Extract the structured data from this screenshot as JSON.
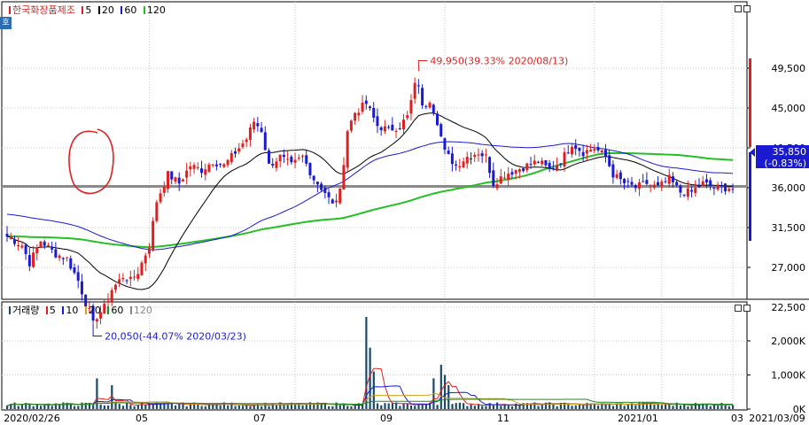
{
  "qmark": "호",
  "price_legend": {
    "title": "한국화장품제조",
    "ma": [
      {
        "label": "5",
        "color": "#e02020"
      },
      {
        "label": "20",
        "color": "#000000"
      },
      {
        "label": "60",
        "color": "#1a1ad0"
      },
      {
        "label": "120",
        "color": "#22c022"
      }
    ]
  },
  "volume_legend": {
    "title": "거래량",
    "ma": [
      {
        "label": "5",
        "color": "#e02020"
      },
      {
        "label": "10",
        "color": "#1a1ad0"
      },
      {
        "label": "20",
        "color": "#d4a020"
      },
      {
        "label": "60",
        "color": "#228822"
      },
      {
        "label": "120",
        "color": "#888888"
      }
    ]
  },
  "colors": {
    "up": "#e02020",
    "down": "#1a1ad0",
    "ma120": "#22c022",
    "volume": "#1a4a6a",
    "refline": "#8a8a8a"
  },
  "annotations": {
    "high": "49,950(39.33% 2020/08/13)",
    "low": "20,050(-44.07% 2020/03/23)"
  },
  "current": {
    "price": "35,850",
    "change": "(-0.83%)"
  },
  "chart_data": {
    "type": "candlestick",
    "title": "한국화장품제조",
    "price_axis": {
      "ticks": [
        "49,500",
        "45,000",
        "40,500",
        "36,000",
        "31,500",
        "27,000",
        "22,500"
      ],
      "range": [
        18000,
        52000
      ]
    },
    "volume_axis": {
      "ticks": [
        "2,000K",
        "1,000K",
        "0K"
      ],
      "range": [
        0,
        2900000
      ]
    },
    "x_ticks": [
      "2020/02/26",
      "05",
      "07",
      "09",
      "11",
      "2021/01",
      "03",
      "2021/03/09"
    ],
    "reference_price": 36150,
    "high": {
      "value": 49950,
      "change_pct": 39.33,
      "date": "2020/08/13"
    },
    "low": {
      "value": 20050,
      "change_pct": -44.07,
      "date": "2020/03/23"
    },
    "last": {
      "value": 35850,
      "change_pct": -0.83
    },
    "close_path": [
      [
        0,
        30500
      ],
      [
        4,
        29500
      ],
      [
        6,
        27500
      ],
      [
        9,
        30000
      ],
      [
        13,
        28500
      ],
      [
        16,
        28000
      ],
      [
        19,
        25500
      ],
      [
        21,
        23000
      ],
      [
        23,
        21000
      ],
      [
        26,
        22500
      ],
      [
        28,
        24500
      ],
      [
        31,
        26000
      ],
      [
        33,
        25500
      ],
      [
        35,
        26500
      ],
      [
        38,
        29500
      ],
      [
        40,
        34500
      ],
      [
        43,
        37500
      ],
      [
        46,
        36500
      ],
      [
        49,
        38500
      ],
      [
        52,
        38000
      ],
      [
        55,
        39000
      ],
      [
        58,
        38500
      ],
      [
        61,
        40000
      ],
      [
        64,
        41500
      ],
      [
        66,
        43500
      ],
      [
        68,
        42500
      ],
      [
        70,
        38500
      ],
      [
        73,
        39500
      ],
      [
        76,
        38500
      ],
      [
        79,
        39500
      ],
      [
        82,
        37000
      ],
      [
        85,
        35500
      ],
      [
        87,
        34000
      ],
      [
        89,
        35500
      ],
      [
        91,
        42500
      ],
      [
        93,
        44500
      ],
      [
        96,
        45500
      ],
      [
        99,
        43000
      ],
      [
        102,
        42500
      ],
      [
        105,
        43000
      ],
      [
        107,
        44000
      ],
      [
        109,
        47500
      ],
      [
        111,
        45000
      ],
      [
        113,
        46000
      ],
      [
        115,
        43500
      ],
      [
        117,
        40000
      ],
      [
        120,
        38500
      ],
      [
        123,
        39500
      ],
      [
        126,
        40000
      ],
      [
        128,
        39500
      ],
      [
        130,
        36500
      ],
      [
        133,
        37500
      ],
      [
        136,
        38000
      ],
      [
        139,
        38500
      ],
      [
        142,
        39000
      ],
      [
        145,
        38000
      ],
      [
        148,
        39000
      ],
      [
        151,
        41000
      ],
      [
        154,
        40000
      ],
      [
        157,
        40500
      ],
      [
        160,
        39500
      ],
      [
        162,
        37500
      ],
      [
        165,
        36500
      ],
      [
        168,
        36000
      ],
      [
        171,
        36500
      ],
      [
        174,
        36000
      ],
      [
        177,
        37000
      ],
      [
        180,
        35500
      ],
      [
        183,
        35500
      ],
      [
        186,
        36500
      ],
      [
        189,
        36000
      ],
      [
        192,
        36000
      ],
      [
        194,
        36000
      ]
    ],
    "series": [
      {
        "name": "5",
        "values": "5-day moving average of close"
      },
      {
        "name": "20",
        "values": "20-day moving average of close"
      },
      {
        "name": "60",
        "values": "60-day moving average of close"
      },
      {
        "name": "120",
        "values": "120-day moving average of close"
      }
    ],
    "volume_spikes": [
      [
        24,
        900000
      ],
      [
        28,
        700000
      ],
      [
        96,
        2700000
      ],
      [
        97,
        1800000
      ],
      [
        98,
        1100000
      ],
      [
        114,
        900000
      ],
      [
        116,
        1300000
      ],
      [
        117,
        1000000
      ],
      [
        118,
        700000
      ],
      [
        170,
        200000
      ]
    ]
  }
}
